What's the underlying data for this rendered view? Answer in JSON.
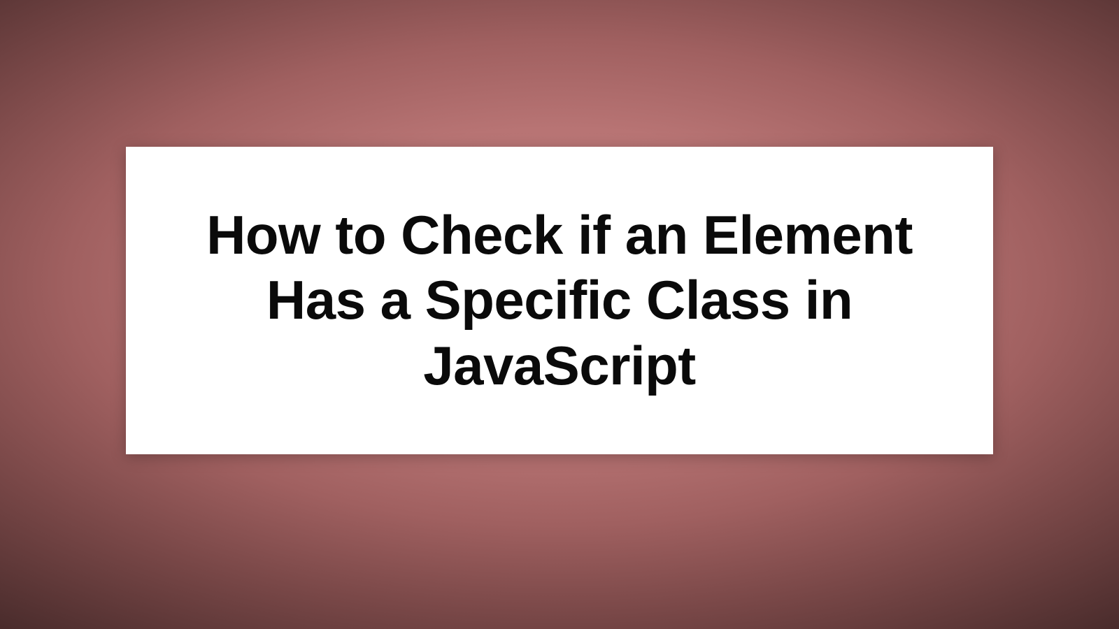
{
  "card": {
    "title": "How to Check if an Element Has a Specific Class in JavaScript"
  },
  "colors": {
    "background_center": "#c78585",
    "background_edge": "#4a2c2c",
    "card_bg": "#ffffff",
    "text": "#0a0a0a"
  }
}
